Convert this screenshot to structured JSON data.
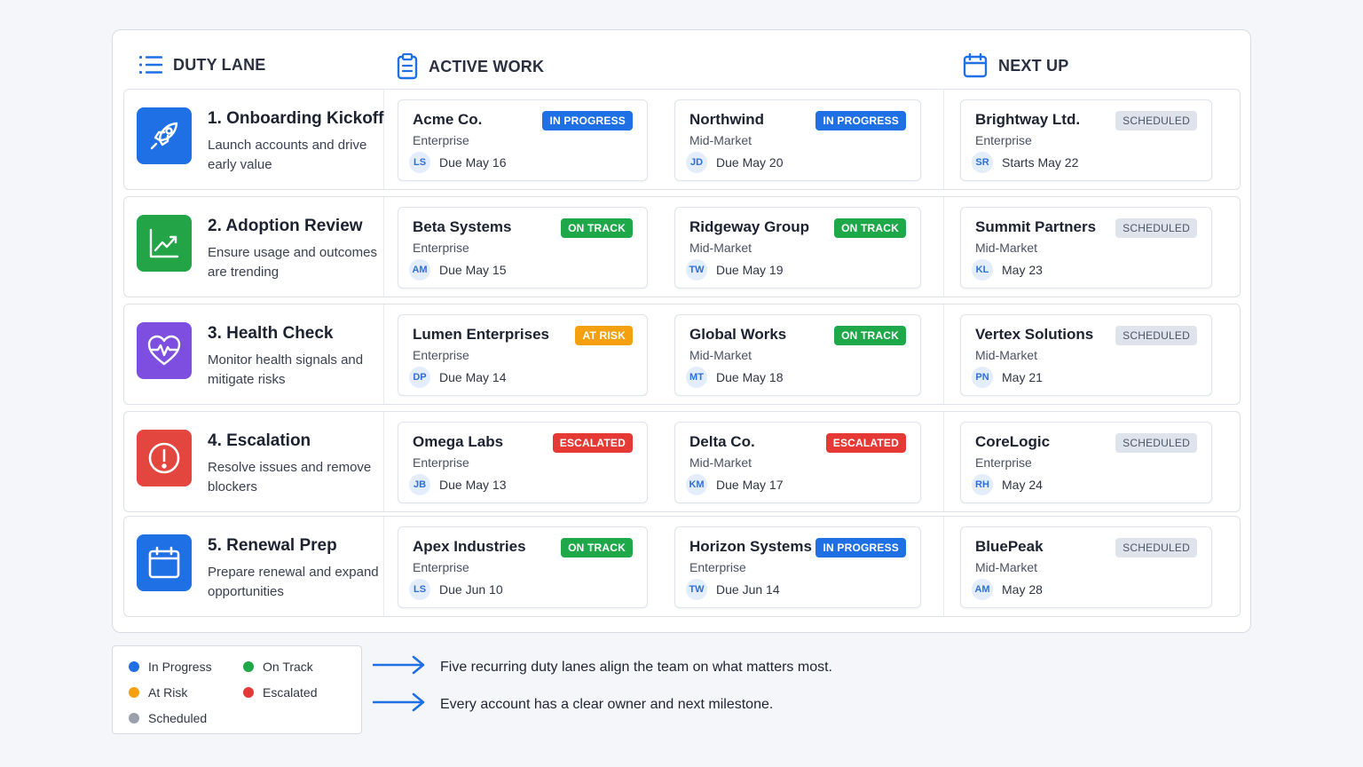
{
  "headers": {
    "lane": "DUTY LANE",
    "active": "ACTIVE WORK",
    "next": "NEXT UP"
  },
  "colors": {
    "in_progress": "#1f6fe5",
    "on_track": "#1ea84a",
    "at_risk": "#f5a00f",
    "escalated": "#e53935",
    "scheduled": "#dfe4ec"
  },
  "rows": [
    {
      "lane": {
        "title": "1. Onboarding Kickoff",
        "desc": "Launch accounts and drive early value",
        "icon": "rocket-icon",
        "color": "#1f6fe5"
      },
      "active": [
        {
          "name": "Acme Co.",
          "segment": "Enterprise",
          "status": "IN PROGRESS",
          "owner": "LS",
          "due": "Due May 16"
        },
        {
          "name": "Northwind",
          "segment": "Mid-Market",
          "status": "IN PROGRESS",
          "owner": "JD",
          "due": "Due May 20"
        }
      ],
      "next": {
        "name": "Brightway Ltd.",
        "segment": "Enterprise",
        "status": "SCHEDULED",
        "owner": "SR",
        "due": "Starts May 22"
      }
    },
    {
      "lane": {
        "title": "2. Adoption Review",
        "desc": "Ensure usage and outcomes are trending",
        "icon": "trending-chart-icon",
        "color": "#22a447"
      },
      "active": [
        {
          "name": "Beta Systems",
          "segment": "Enterprise",
          "status": "ON TRACK",
          "owner": "AM",
          "due": "Due May 15"
        },
        {
          "name": "Ridgeway Group",
          "segment": "Mid-Market",
          "status": "ON TRACK",
          "owner": "TW",
          "due": "Due May 19"
        }
      ],
      "next": {
        "name": "Summit Partners",
        "segment": "Mid-Market",
        "status": "SCHEDULED",
        "owner": "KL",
        "due": "May 23"
      }
    },
    {
      "lane": {
        "title": "3. Health Check",
        "desc": "Monitor health signals and mitigate risks",
        "icon": "heartbeat-icon",
        "color": "#7d4ee0"
      },
      "active": [
        {
          "name": "Lumen Enterprises",
          "segment": "Enterprise",
          "status": "AT RISK",
          "owner": "DP",
          "due": "Due May 14"
        },
        {
          "name": "Global Works",
          "segment": "Mid-Market",
          "status": "ON TRACK",
          "owner": "MT",
          "due": "Due May 18"
        }
      ],
      "next": {
        "name": "Vertex Solutions",
        "segment": "Mid-Market",
        "status": "SCHEDULED",
        "owner": "PN",
        "due": "May 21"
      }
    },
    {
      "lane": {
        "title": "4. Escalation",
        "desc": "Resolve issues and remove blockers",
        "icon": "alert-icon",
        "color": "#e2463f"
      },
      "active": [
        {
          "name": "Omega Labs",
          "segment": "Enterprise",
          "status": "ESCALATED",
          "owner": "JB",
          "due": "Due May 13"
        },
        {
          "name": "Delta Co.",
          "segment": "Mid-Market",
          "status": "ESCALATED",
          "owner": "KM",
          "due": "Due May 17"
        }
      ],
      "next": {
        "name": "CoreLogic",
        "segment": "Enterprise",
        "status": "SCHEDULED",
        "owner": "RH",
        "due": "May 24"
      }
    },
    {
      "lane": {
        "title": "5. Renewal Prep",
        "desc": "Prepare renewal and expand opportunities",
        "icon": "calendar-icon",
        "color": "#1f6fe5"
      },
      "active": [
        {
          "name": "Apex Industries",
          "segment": "Enterprise",
          "status": "ON TRACK",
          "owner": "LS",
          "due": "Due Jun 10"
        },
        {
          "name": "Horizon Systems",
          "segment": "Enterprise",
          "status": "IN PROGRESS",
          "owner": "TW",
          "due": "Due Jun 14"
        }
      ],
      "next": {
        "name": "BluePeak",
        "segment": "Mid-Market",
        "status": "SCHEDULED",
        "owner": "AM",
        "due": "May 28"
      }
    }
  ],
  "legend": {
    "in_progress": "In Progress",
    "on_track": "On Track",
    "at_risk": "At Risk",
    "escalated": "Escalated",
    "scheduled": "Scheduled"
  },
  "notes": [
    "Five recurring duty lanes align the team on what matters most.",
    "Every account has a clear owner and next milestone."
  ]
}
